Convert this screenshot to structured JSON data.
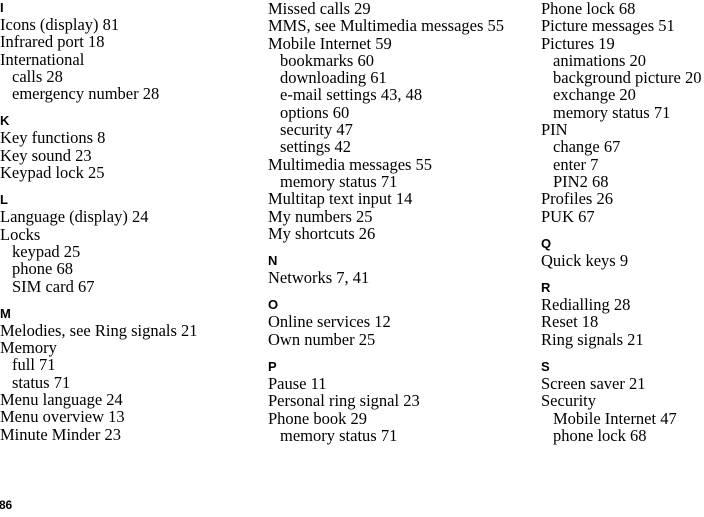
{
  "document": {
    "type": "index-page",
    "page_number": "86",
    "columns": [
      {
        "id": "column-1",
        "sections": [
          {
            "letter": "I",
            "entries": [
              {
                "text": "Icons (display) 81",
                "level": 0
              },
              {
                "text": "Infrared port 18",
                "level": 0
              },
              {
                "text": "International",
                "level": 0
              },
              {
                "text": "calls 28",
                "level": 1
              },
              {
                "text": "emergency number 28",
                "level": 1
              }
            ]
          },
          {
            "letter": "K",
            "entries": [
              {
                "text": "Key functions 8",
                "level": 0
              },
              {
                "text": "Key sound 23",
                "level": 0
              },
              {
                "text": "Keypad lock 25",
                "level": 0
              }
            ]
          },
          {
            "letter": "L",
            "entries": [
              {
                "text": "Language (display) 24",
                "level": 0
              },
              {
                "text": "Locks",
                "level": 0
              },
              {
                "text": "keypad 25",
                "level": 1
              },
              {
                "text": "phone 68",
                "level": 1
              },
              {
                "text": "SIM card 67",
                "level": 1
              }
            ]
          },
          {
            "letter": "M",
            "entries": [
              {
                "text": "Melodies, see Ring signals 21",
                "level": 0
              },
              {
                "text": "Memory",
                "level": 0
              },
              {
                "text": "full 71",
                "level": 1
              },
              {
                "text": "status 71",
                "level": 1
              },
              {
                "text": "Menu language 24",
                "level": 0
              },
              {
                "text": "Menu overview 13",
                "level": 0
              },
              {
                "text": "Minute Minder 23",
                "level": 0
              }
            ]
          }
        ]
      },
      {
        "id": "column-2",
        "sections": [
          {
            "letter": "",
            "entries": [
              {
                "text": "Missed calls 29",
                "level": 0
              },
              {
                "text": "MMS, see Multimedia messages 55",
                "level": 0
              },
              {
                "text": "Mobile Internet 59",
                "level": 0
              },
              {
                "text": "bookmarks 60",
                "level": 1
              },
              {
                "text": "downloading 61",
                "level": 1
              },
              {
                "text": "e-mail settings 43, 48",
                "level": 1
              },
              {
                "text": "options 60",
                "level": 1
              },
              {
                "text": "security 47",
                "level": 1
              },
              {
                "text": "settings 42",
                "level": 1
              },
              {
                "text": "Multimedia messages 55",
                "level": 0
              },
              {
                "text": "memory status 71",
                "level": 1
              },
              {
                "text": "Multitap text input 14",
                "level": 0
              },
              {
                "text": "My numbers 25",
                "level": 0
              },
              {
                "text": "My shortcuts 26",
                "level": 0
              }
            ]
          },
          {
            "letter": "N",
            "entries": [
              {
                "text": "Networks 7, 41",
                "level": 0
              }
            ]
          },
          {
            "letter": "O",
            "entries": [
              {
                "text": "Online services 12",
                "level": 0
              },
              {
                "text": "Own number 25",
                "level": 0
              }
            ]
          },
          {
            "letter": "P",
            "entries": [
              {
                "text": "Pause 11",
                "level": 0
              },
              {
                "text": "Personal ring signal 23",
                "level": 0
              },
              {
                "text": "Phone book 29",
                "level": 0
              },
              {
                "text": "memory status 71",
                "level": 1
              }
            ]
          }
        ]
      },
      {
        "id": "column-3",
        "sections": [
          {
            "letter": "",
            "entries": [
              {
                "text": "Phone lock 68",
                "level": 0
              },
              {
                "text": "Picture messages 51",
                "level": 0
              },
              {
                "text": "Pictures 19",
                "level": 0
              },
              {
                "text": "animations 20",
                "level": 1
              },
              {
                "text": "background picture 20",
                "level": 1
              },
              {
                "text": "exchange 20",
                "level": 1
              },
              {
                "text": "memory status 71",
                "level": 1
              },
              {
                "text": "PIN",
                "level": 0
              },
              {
                "text": "change 67",
                "level": 1
              },
              {
                "text": "enter 7",
                "level": 1
              },
              {
                "text": "PIN2 68",
                "level": 1
              },
              {
                "text": "Profiles 26",
                "level": 0
              },
              {
                "text": "PUK 67",
                "level": 0
              }
            ]
          },
          {
            "letter": "Q",
            "entries": [
              {
                "text": "Quick keys 9",
                "level": 0
              }
            ]
          },
          {
            "letter": "R",
            "entries": [
              {
                "text": "Redialling 28",
                "level": 0
              },
              {
                "text": "Reset 18",
                "level": 0
              },
              {
                "text": "Ring signals 21",
                "level": 0
              }
            ]
          },
          {
            "letter": "S",
            "entries": [
              {
                "text": "Screen saver 21",
                "level": 0
              },
              {
                "text": "Security",
                "level": 0
              },
              {
                "text": "Mobile Internet 47",
                "level": 1
              },
              {
                "text": "phone lock 68",
                "level": 1
              }
            ]
          }
        ]
      }
    ]
  }
}
